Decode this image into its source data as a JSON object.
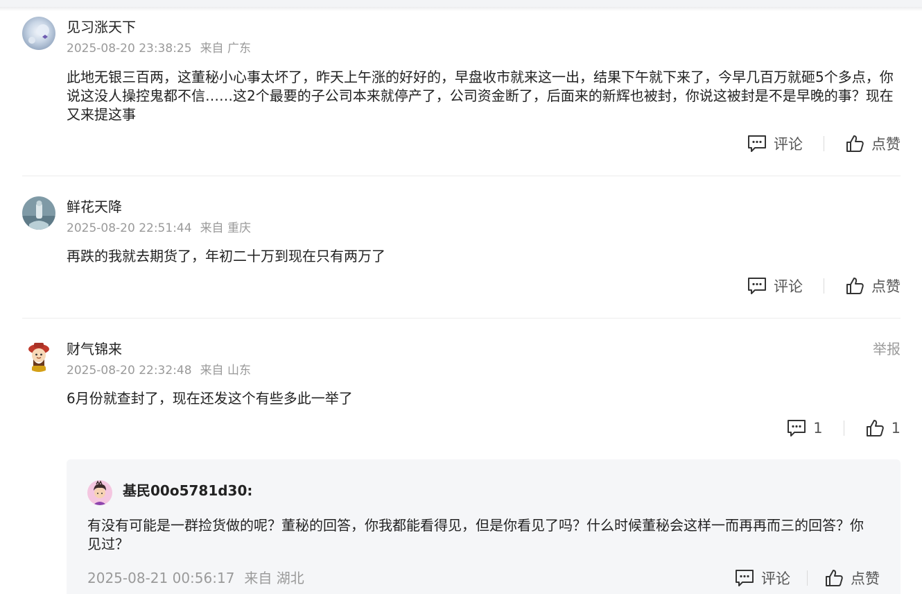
{
  "comments": [
    {
      "username": "见习涨天下",
      "time": "2025-08-20 23:38:25",
      "location": "来自 广东",
      "text": "此地无银三百两，这董秘小心事太坏了，昨天上午涨的好好的，早盘收市就来这一出，结果下午就下来了，今早几百万就砸5个多点，你说这没人操控鬼都不信……这2个最要的子公司本来就停产了，公司资金断了，后面来的新辉也被封，你说这被封是不是早晚的事？现在又来提这事",
      "comment_label": "评论",
      "like_label": "点赞"
    },
    {
      "username": "鲜花天降",
      "time": "2025-08-20 22:51:44",
      "location": "来自 重庆",
      "text": "再跌的我就去期货了，年初二十万到现在只有两万了",
      "comment_label": "评论",
      "like_label": "点赞"
    },
    {
      "username": "财气锦来",
      "time": "2025-08-20 22:32:48",
      "location": "来自 山东",
      "text": "6月份就查封了，现在还发这个有些多此一举了",
      "report_label": "举报",
      "comment_count": "1",
      "like_count": "1",
      "reply": {
        "username": "基民00o5781d30:",
        "text": "有没有可能是一群捡货做的呢？董秘的回答，你我都能看得见，但是你看见了吗？什么时候董秘会这样一而再再而三的回答？你见过？",
        "time": "2025-08-21 00:56:17",
        "location": "来自 湖北",
        "comment_label": "评论",
        "like_label": "点赞"
      }
    }
  ],
  "icons": {
    "comment": "comment-icon",
    "like": "thumbs-up-icon"
  },
  "colors": {
    "text": "#222222",
    "muted": "#9a9a9a",
    "reply_bg": "#f5f6f8"
  }
}
